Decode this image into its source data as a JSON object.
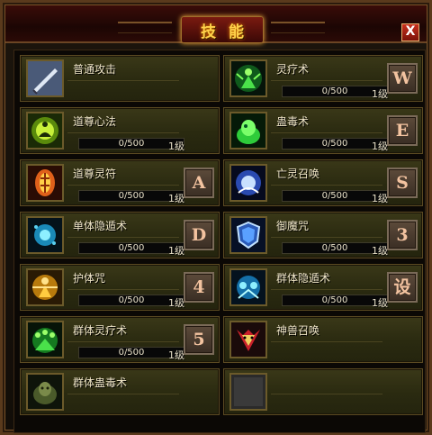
{
  "window": {
    "title": "技能",
    "close_label": "X"
  },
  "skills": [
    {
      "name": "普通攻击",
      "exp": "",
      "level": "",
      "hotkey": "",
      "icon": "sword-icon"
    },
    {
      "name": "灵疗术",
      "exp": "0/500",
      "level": "1级",
      "hotkey": "W",
      "icon": "heal-spirit-icon"
    },
    {
      "name": "道尊心法",
      "exp": "0/500",
      "level": "1级",
      "hotkey": "",
      "icon": "meditation-icon"
    },
    {
      "name": "蛊毒术",
      "exp": "0/500",
      "level": "1级",
      "hotkey": "E",
      "icon": "poison-icon"
    },
    {
      "name": "道尊灵符",
      "exp": "0/500",
      "level": "1级",
      "hotkey": "A",
      "icon": "talisman-icon"
    },
    {
      "name": "亡灵召唤",
      "exp": "0/500",
      "level": "1级",
      "hotkey": "S",
      "icon": "undead-summon-icon"
    },
    {
      "name": "单体隐遁术",
      "exp": "0/500",
      "level": "1级",
      "hotkey": "D",
      "icon": "stealth-icon"
    },
    {
      "name": "御魔咒",
      "exp": "0/500",
      "level": "1级",
      "hotkey": "3",
      "icon": "shield-icon"
    },
    {
      "name": "护体咒",
      "exp": "0/500",
      "level": "1级",
      "hotkey": "4",
      "icon": "body-guard-icon"
    },
    {
      "name": "群体隐遁术",
      "exp": "0/500",
      "level": "1级",
      "hotkey": "设",
      "icon": "group-stealth-icon"
    },
    {
      "name": "群体灵疗术",
      "exp": "0/500",
      "level": "1级",
      "hotkey": "5",
      "icon": "group-heal-icon"
    },
    {
      "name": "神兽召唤",
      "exp": "",
      "level": "",
      "hotkey": "",
      "icon": "beast-summon-icon"
    },
    {
      "name": "群体蛊毒术",
      "exp": "",
      "level": "",
      "hotkey": "",
      "icon": "group-poison-icon"
    },
    {
      "name": "",
      "exp": "",
      "level": "",
      "hotkey": "",
      "icon": "empty-slot-icon"
    }
  ]
}
